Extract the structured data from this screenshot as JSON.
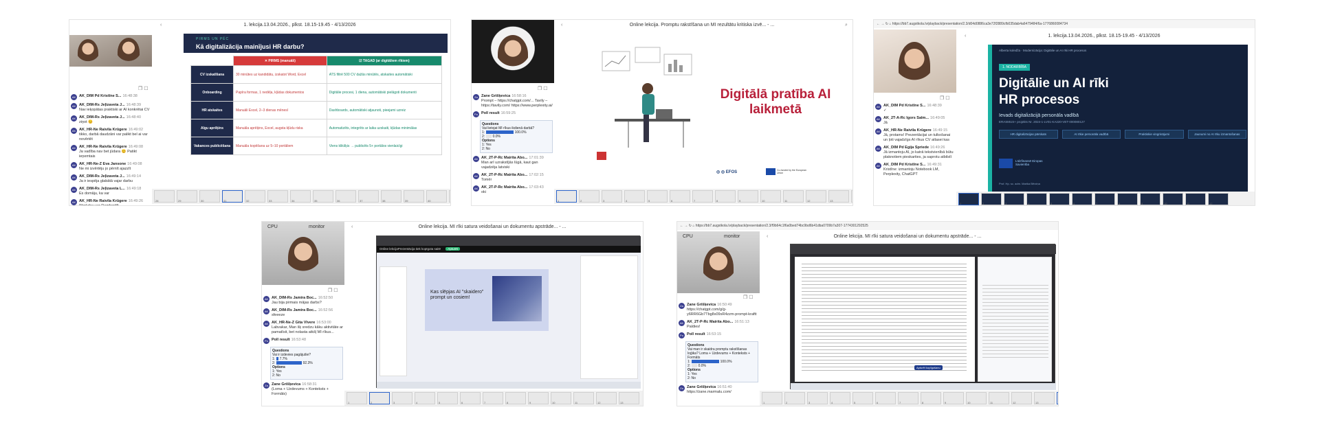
{
  "p1": {
    "chat": [
      {
        "name": "AK_DIM Pd Kristīne S...",
        "time": "16:48:38",
        "text": ""
      },
      {
        "name": "AK_DIM-Rs Jeļizaveta J...",
        "time": "16:48:39",
        "text": "Nav ieķopātas praktiski ar AI konkrētai CV"
      },
      {
        "name": "AK_DIM-Rs Jeļizaveta J...",
        "time": "16:48:40",
        "text": "ziņot 😊"
      },
      {
        "name": "AK_HR-Ne Raivila Krūgere",
        "time": "16:49:02",
        "text": "tikko, darbā daudzāni var palikt bel ai var novērtēt"
      },
      {
        "name": "AK_HR-Ne Raivila Krūgere",
        "time": "16:49:08",
        "text": "Ja vadība nav bet jūdara 😊 Patikt ieņemtais"
      },
      {
        "name": "AK_HR-Ne-Z Eva Jansone",
        "time": "16:49:08",
        "text": "Ne mi izvērtēju jo pērnīt ajazzīt"
      },
      {
        "name": "AK_DIM-Rs Jeļizaveta J...",
        "time": "16:49:14",
        "text": "Ja ir iespēja glabātā vajar darbu"
      },
      {
        "name": "AK_DIM-Rs Jeļizaveta L...",
        "time": "16:49:18",
        "text": "Es domāju, ka var"
      },
      {
        "name": "AK_HR-Ne Raivila Krūgere",
        "time": "16:49:26",
        "text": "Workday  var Damboriift"
      },
      {
        "name": "AK_DIM Pd Kristīne S...",
        "time": "16:49:30",
        "text": ""
      }
    ],
    "session_title": "1. lekcija.13.04.2026., plkst. 18.15-19.45 - 4/13/2026",
    "slide_kicker": "PIRMS UN PĒC",
    "slide_title": "Kā digitalizācija mainījusi HR darbu?",
    "col_before": "✕ PIRMS (manuāli)",
    "col_after": "☑ TAGAD (ar digitāliem rīkiem)",
    "rows": [
      {
        "label": "CV izskatīšana",
        "before": "30 minūtes uz kandidātu, izskatot Word, Excel",
        "after": "ATS filtrē 500 CV dažās minūtēs, atskaites automātiski"
      },
      {
        "label": "Onboarding",
        "before": "Papīra formas, 1 nedēļa, kļūdas dokumentos",
        "after": "Digitālie procesi, 1 diena, automātiski pielāgoti dokumenti"
      },
      {
        "label": "HR atskaites",
        "before": "Manuāli Excel, 2–3 dienas mēnesī",
        "after": "Dashboards, automātiski atjaunoti, pieejami uzreiz"
      },
      {
        "label": "Algu aprēķins",
        "before": "Manuāla aprēķins, Excel, augsta kļūdu riska",
        "after": "Automatizēts, integrēts ar laika uzskaiti, kļūdas minimālas"
      },
      {
        "label": "Vakances publicēšana",
        "before": "Manuāla kopēšana uz 5–10 portāliem",
        "after": "Viens klikšķis → publicēts 5+ portālos vienlaicīgi"
      }
    ],
    "thumbs": [
      "28",
      "29",
      "30",
      "31",
      "32",
      "33",
      "34",
      "35",
      "36",
      "37",
      "38",
      "39",
      "40",
      "41"
    ]
  },
  "p2": {
    "session_title": "Online lekcija. Promptu rakstīšana un MI rezultātu kritiska izvē... - ...",
    "slide_title_line1": "Digitālā pratība AI",
    "slide_title_line2": "laikmetā",
    "logos": "◎ ◎  EFOS",
    "eu_text": "Co-funded by the European Union",
    "chat": [
      {
        "name": "Zane Grišķevica",
        "time": "16:58:16",
        "text": "Prompt – https://chatgpt.com/... Tavily – https://tavily.com/ https://www.perplexity.ai/"
      },
      {
        "name": "Poll result",
        "time": "16:59:25",
        "text": ""
      }
    ],
    "poll_question": "Questions",
    "poll_q_text": "Vai lietojat MI rīkus ikdienā darbā?",
    "poll_rows": [
      {
        "label": "1:",
        "pct": "100.0%"
      },
      {
        "label": "2:",
        "pct": "0.0%"
      }
    ],
    "options_label": "Options",
    "options": [
      "1: Yes",
      "2: No"
    ],
    "chat2": [
      {
        "name": "AK_2T-P-Rc Mairita Abo...",
        "time": "17:01:39",
        "text": "Man arī uzrakstījās lūgā, kaut gan vajadzēja latviski"
      },
      {
        "name": "AK_2T-P-Rc Mairita Abo...",
        "time": "17:02:15",
        "text": "Tomēr"
      },
      {
        "name": "AK_2T-P-Rc Mairita Abo...",
        "time": "17:03:43",
        "text": "oki"
      }
    ],
    "thumbs": [
      "1",
      "2",
      "3",
      "4",
      "5",
      "6",
      "7",
      "8",
      "9",
      "10",
      "11",
      "12",
      "13",
      "14"
    ]
  },
  "p3": {
    "url": "https://bb7.augstkola.lv/playback/presentation/2.3/d04d0886ca3e72f2889cfb035dab4a6479484/6a-1776860084734",
    "session_title": "1. lekcija.13.04.2026., plkst. 18.15-19.45 - 4/13/2026",
    "breadcrumb": "Alberta koledža · Modernizācija: Digitālie un AI rīki HR procesos",
    "badge": "1. NODARBĪBA",
    "title_line1": "Digitālie un AI rīki",
    "title_line2": "HR procesos",
    "subtitle": "Ievads digitalizācijā personāla vadībā",
    "project": "ERASMUS+ projekts Nr. 2024-1-LV01-KA220-VET-000080127",
    "chips": [
      "HR digitalizācijas pārskats",
      "AI rīkie personāla vadībā",
      "Praktiskie vingrinājumi",
      "Jaunumi no AI rīku izmantošanas"
    ],
    "eu_text": "Līdzfinansē Eiropas Savienība",
    "author": "Prof. Hp. sc. adm. Marika Bērziņa",
    "chat": [
      {
        "name": "AK_DIM Pd Kristīne S...",
        "time": "16:48:39",
        "text": "✓"
      },
      {
        "name": "AK_2T-A-Rc Igors Salm...",
        "time": "16:49:05",
        "text": "Jā"
      },
      {
        "name": "AK_HR-Ne Raivila Krūgere",
        "time": "16:49:15",
        "text": "Jā, protams! Prezentācijai un tulkošanai un ļoti vajadzīgs AI rīkus CV atlasei kas"
      },
      {
        "name": "AK_DIM Pd Egija Spriede",
        "time": "16:49:26",
        "text": "Jā izmantoju AI, jo katrā tekstvienībā būtu plaknotiem pieskarties, ja saprotu atbilstī"
      },
      {
        "name": "AK_DIM Pd Kristīne S...",
        "time": "16:49:31",
        "text": "Kristīne: izmantoju Notebook LM, Perplexity, ChatGPT"
      }
    ],
    "thumbs": [
      "1",
      "2",
      "3",
      "4",
      "5",
      "6",
      "7",
      "8",
      "9",
      "10",
      "11",
      "12"
    ]
  },
  "p4": {
    "cam_labels": [
      "CPU",
      "monitor"
    ],
    "session_title": "Online lekcija. MI rīki satura veidošanai un dokumentu apstrāde... - ...",
    "share_bar": "Online lekcijaPrezentācija tiek kopīgota saitē",
    "share_btn": "Apturēt",
    "slide_caption": "Kas slēpjas AI \"skaidero\" prompt un cosiem!",
    "chat": [
      {
        "name": "AK_DIM-Rs Jamira Boc...",
        "time": "16:52:50",
        "text": "Jau bija pirmais mājas darbs?"
      },
      {
        "name": "AK_DIM-Rs Jamira Boc...",
        "time": "16:52:56",
        "text": "sfeeeze"
      },
      {
        "name": "AK_HR-Ne-Z Gita Vīvere",
        "time": "16:53:00",
        "text": "Labvakar, Man šķ sredzu kāku aktivitāte ar pamatīsit, bet nolasta atkšļ MI rīkus..."
      },
      {
        "name": "Poll result",
        "time": "16:53:48",
        "text": ""
      }
    ],
    "poll_question": "Questions",
    "poll_q_text": "Vai ir izdevies pagājušie?",
    "poll_rows": [
      {
        "label": "1:",
        "pct": "7.7%"
      },
      {
        "label": "2:",
        "pct": "92.3%"
      }
    ],
    "options_label": "Options",
    "options": [
      "1: Yes",
      "2: No"
    ],
    "chat2": [
      {
        "name": "Zane Grišķevica",
        "time": "16:58:31",
        "text": "(Loma + Uzdevums + Konteksts + Formāts)"
      }
    ],
    "thumbs": [
      "1",
      "2",
      "3",
      "4",
      "5",
      "6",
      "7",
      "8",
      "9",
      "10",
      "11",
      "12",
      "13"
    ]
  },
  "p5": {
    "url": "https://bb7.augstkola.lv/playback/presentation/2.3/f9b64c1f6a0bed74bc9bd6b41dba0709b7a307-1774301292525",
    "cam_labels": [
      "CPU",
      "monitor"
    ],
    "session_title": "Online lekcija. MI rīki satura veidošanai un dokumentu apstrāde... - ...",
    "chat": [
      {
        "name": "Zane Grišķevica",
        "time": "16:50:49",
        "text": "https://chatgpt.com/g/g-y6RR6Gb7Tbg8s09sR4zzm-prompt-kraftt"
      },
      {
        "name": "AK_2T-P-Rc Mairita Abo...",
        "time": "16:51:13",
        "text": "Paldies!"
      },
      {
        "name": "Poll result",
        "time": "16:53:15",
        "text": ""
      }
    ],
    "poll_question": "Questions",
    "poll_q_text": "Vai man ir skaidra promptu rakstīšanas loģika? Loma + Uzdevums + Konteksts + Formāts",
    "poll_rows": [
      {
        "label": "1:",
        "pct": "100.0%"
      },
      {
        "label": "2:",
        "pct": "0.0%"
      }
    ],
    "options_label": "Options",
    "options": [
      "1: Yes",
      "2: No"
    ],
    "chat2": [
      {
        "name": "Zane Grišķevica",
        "time": "16:51:40",
        "text": "https://zane.marmalu.com/"
      }
    ],
    "share_btn": "Apturēt kopīgošanu",
    "thumbs": [
      "1",
      "2",
      "3",
      "4",
      "5",
      "6",
      "7",
      "8",
      "9",
      "10",
      "11",
      "12",
      "13",
      "14",
      "15"
    ]
  }
}
